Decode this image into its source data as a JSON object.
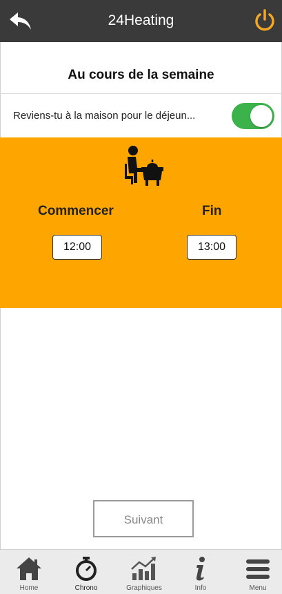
{
  "header": {
    "title": "24Heating",
    "back_icon": "back-arrow-icon",
    "power_icon": "power-icon",
    "power_color": "#f5a623"
  },
  "page": {
    "title": "Au cours de la semaine"
  },
  "lunch_toggle": {
    "label": "Reviens-tu à la maison pour le déjeun...",
    "state": "on",
    "color": "#3bb34a"
  },
  "lunch_panel": {
    "background": "#ffa500",
    "icon": "person-dining-icon",
    "start_label": "Commencer",
    "end_label": "Fin",
    "start_time": "12:00",
    "end_time": "13:00"
  },
  "actions": {
    "next_label": "Suivant"
  },
  "tabbar": {
    "items": [
      {
        "label": "Home",
        "icon": "home-icon"
      },
      {
        "label": "Chrono",
        "icon": "stopwatch-icon"
      },
      {
        "label": "Graphiques",
        "icon": "chart-icon"
      },
      {
        "label": "Info",
        "icon": "info-icon"
      },
      {
        "label": "Menu",
        "icon": "hamburger-menu-icon"
      }
    ]
  }
}
